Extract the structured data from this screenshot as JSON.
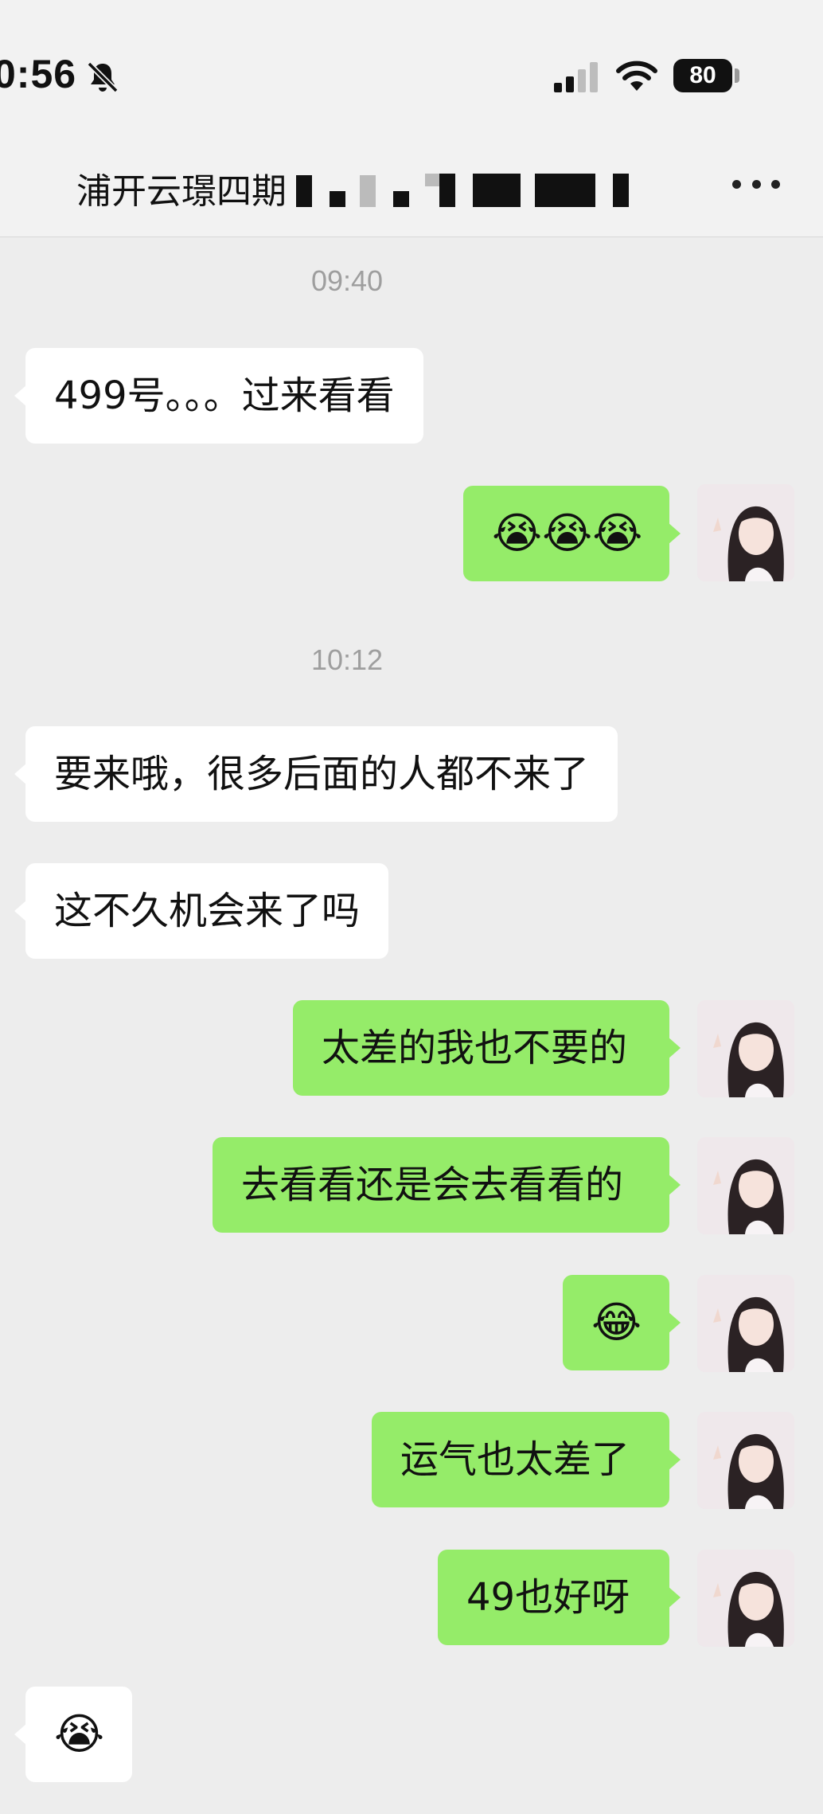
{
  "status_bar": {
    "time": "0:56",
    "battery": "80"
  },
  "header": {
    "title": "浦开云璟四期"
  },
  "messages": [
    {
      "type": "timestamp",
      "text": "09:40"
    },
    {
      "type": "incoming",
      "text": "499号。。。过来看看"
    },
    {
      "type": "outgoing",
      "text": "😭😭😭"
    },
    {
      "type": "timestamp",
      "text": "10:12"
    },
    {
      "type": "incoming",
      "text": "要来哦，很多后面的人都不来了"
    },
    {
      "type": "incoming",
      "text": "这不久机会来了吗"
    },
    {
      "type": "outgoing",
      "text": "太差的我也不要的"
    },
    {
      "type": "outgoing",
      "text": "去看看还是会去看看的"
    },
    {
      "type": "outgoing",
      "text": "😂"
    },
    {
      "type": "outgoing",
      "text": "运气也太差了"
    },
    {
      "type": "outgoing",
      "text": "49也好呀"
    },
    {
      "type": "incoming",
      "text": "😭"
    }
  ],
  "colors": {
    "background": "#ededed",
    "outgoing_bubble": "#95ec69",
    "incoming_bubble": "#ffffff",
    "timestamp": "#9e9e9e"
  },
  "icons": [
    "bell-muted-icon",
    "cellular-signal-icon",
    "wifi-icon",
    "battery-icon",
    "more-icon",
    "avatar"
  ]
}
